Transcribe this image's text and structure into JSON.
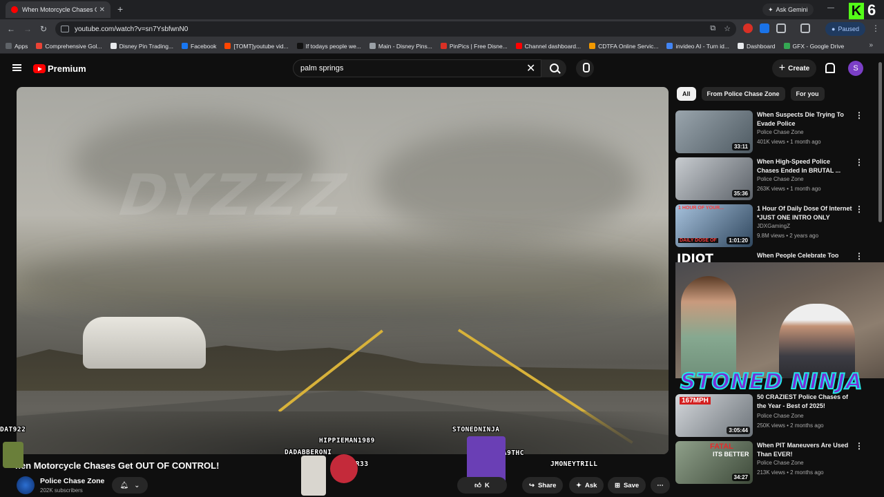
{
  "browser": {
    "tab_title": "When Motorcycle Chases Get O",
    "url": "youtube.com/watch?v=sn7YsbfwnN0",
    "ask_gemini": "Ask Gemini",
    "paused": "Paused",
    "kick_digit": "6"
  },
  "bookmarks": [
    {
      "label": "Apps",
      "color": "#5f6368"
    },
    {
      "label": "Comprehensive Gol...",
      "color": "#ea4335"
    },
    {
      "label": "Disney Pin Trading...",
      "color": "#e8eaed"
    },
    {
      "label": "Facebook",
      "color": "#1877f2"
    },
    {
      "label": "[TOMT]youtube vid...",
      "color": "#ff4500"
    },
    {
      "label": "If todays people we...",
      "color": "#111111"
    },
    {
      "label": "Main - Disney Pins...",
      "color": "#9aa0a6"
    },
    {
      "label": "PinPics | Free Disne...",
      "color": "#d93025"
    },
    {
      "label": "Channel dashboard...",
      "color": "#ff0000"
    },
    {
      "label": "CDTFA Online Servic...",
      "color": "#f29900"
    },
    {
      "label": "invideo AI - Turn id...",
      "color": "#4285f4"
    },
    {
      "label": "Dashboard",
      "color": "#e8eaed"
    },
    {
      "label": "GFX - Google Drive",
      "color": "#34a853"
    }
  ],
  "youtube": {
    "logo_text": "Premium",
    "search_value": "palm springs",
    "create_label": "Create",
    "avatar_letter": "S"
  },
  "video": {
    "title": "hen Motorcycle Chases Get OUT OF CONTROL!",
    "watermark": "DYZZZ",
    "channel_name": "Police Chase Zone",
    "subscribers": "202K subscribers",
    "like_label": "K",
    "share_label": "Share",
    "ask_label": "Ask",
    "save_label": "Save"
  },
  "overlays": {
    "tags": [
      "DAT922",
      "HIPPIEMAN1989",
      "STONEDNINJA",
      "DADABBERONI",
      "JAHFR33",
      "MELTA9THC",
      "JMONEYTRILL"
    ],
    "stoned_ninja": "STONED NINJA",
    "idiot": "IDIOT"
  },
  "chips": [
    "All",
    "From Police Chase Zone",
    "For you"
  ],
  "recommendations": [
    {
      "title": "When Suspects Die Trying To Evade Police",
      "channel": "Police Chase Zone",
      "meta": "401K views • 1 month ago",
      "duration": "33:11",
      "thumb": "#7c8a96"
    },
    {
      "title": "When High-Speed Police Chases Ended In BRUTAL ...",
      "channel": "Police Chase Zone",
      "meta": "263K views • 1 month ago",
      "duration": "35:36",
      "thumb": "#8b9198"
    },
    {
      "title": "1 Hour Of Daily Dose Of Internet *JUST ONE INTRO ONLY",
      "channel": "JDXGamingZ",
      "meta": "9.8M views • 2 years ago",
      "duration": "1:01:20",
      "thumb": "#5f7893"
    },
    {
      "title": "When People Celebrate Too",
      "channel": "",
      "meta": "",
      "duration": "",
      "thumb": "#3a3a3a"
    },
    {
      "title": "50 CRAZIEST Police Chases of the Year - Best of 2025!",
      "channel": "Police Chase Zone",
      "meta": "250K views • 2 months ago",
      "duration": "3:05:44",
      "thumb": "#9ea4a8"
    },
    {
      "title": "When PIT Maneuvers Are Used Than EVER!",
      "channel": "Police Chase Zone",
      "meta": "213K views • 2 months ago",
      "duration": "34:27",
      "thumb": "#7f8a7a"
    }
  ],
  "thumb_texts": {
    "r3": "1 HOUR OF YOUR...",
    "r3b": "DAILY DOSE OF",
    "r5": "167MPH",
    "r6a": "FATAL",
    "r6b": "ITS BETTER"
  }
}
